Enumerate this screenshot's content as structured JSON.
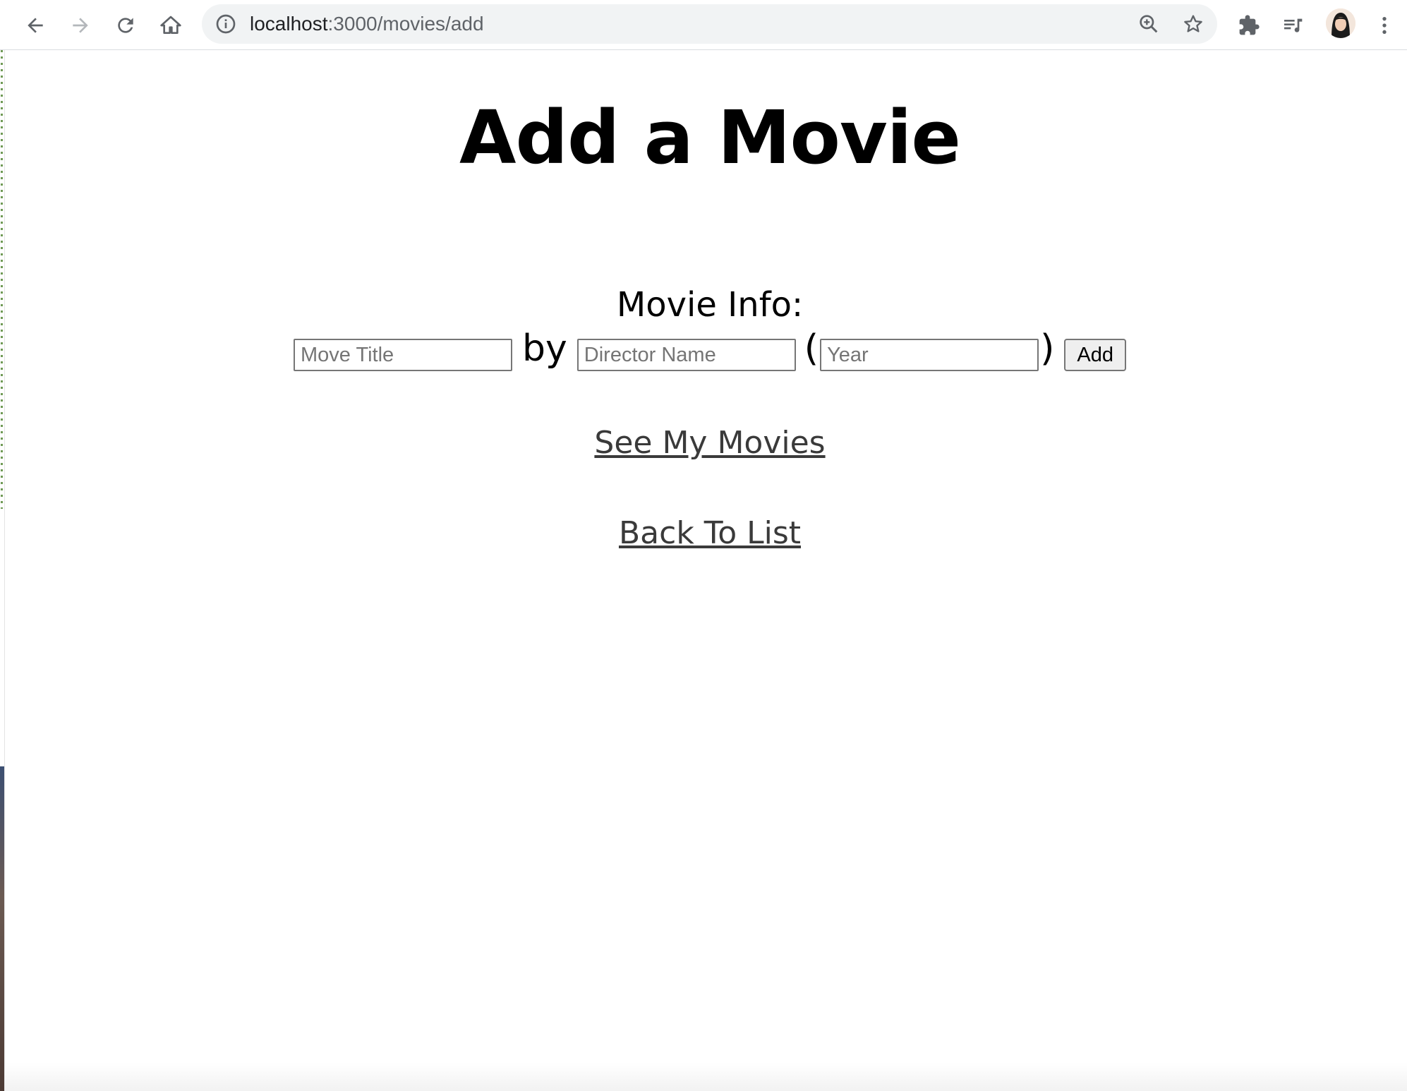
{
  "browser": {
    "url_host": "localhost",
    "url_path": ":3000/movies/add",
    "icons": [
      "back-arrow-icon",
      "forward-arrow-icon",
      "reload-icon",
      "home-icon",
      "site-info-icon",
      "zoom-icon",
      "bookmark-star-icon",
      "extensions-icon",
      "media-control-icon",
      "avatar",
      "menu-kebab-icon"
    ]
  },
  "page": {
    "title": "Add a Movie",
    "section_label": "Movie Info:",
    "form": {
      "title_placeholder": "Move Title",
      "title_value": "",
      "by_text": "by",
      "director_placeholder": "Director Name",
      "director_value": "",
      "open_paren": "(",
      "year_placeholder": "Year",
      "year_value": "",
      "close_paren": ")",
      "add_label": "Add"
    },
    "links": {
      "see_my_movies": "See My Movies",
      "back_to_list": "Back To List"
    }
  },
  "colors": {
    "link": "#3a3a3a",
    "text": "#000000",
    "toolbar_bg": "#ffffff",
    "omnibox_bg": "#f1f3f4"
  }
}
